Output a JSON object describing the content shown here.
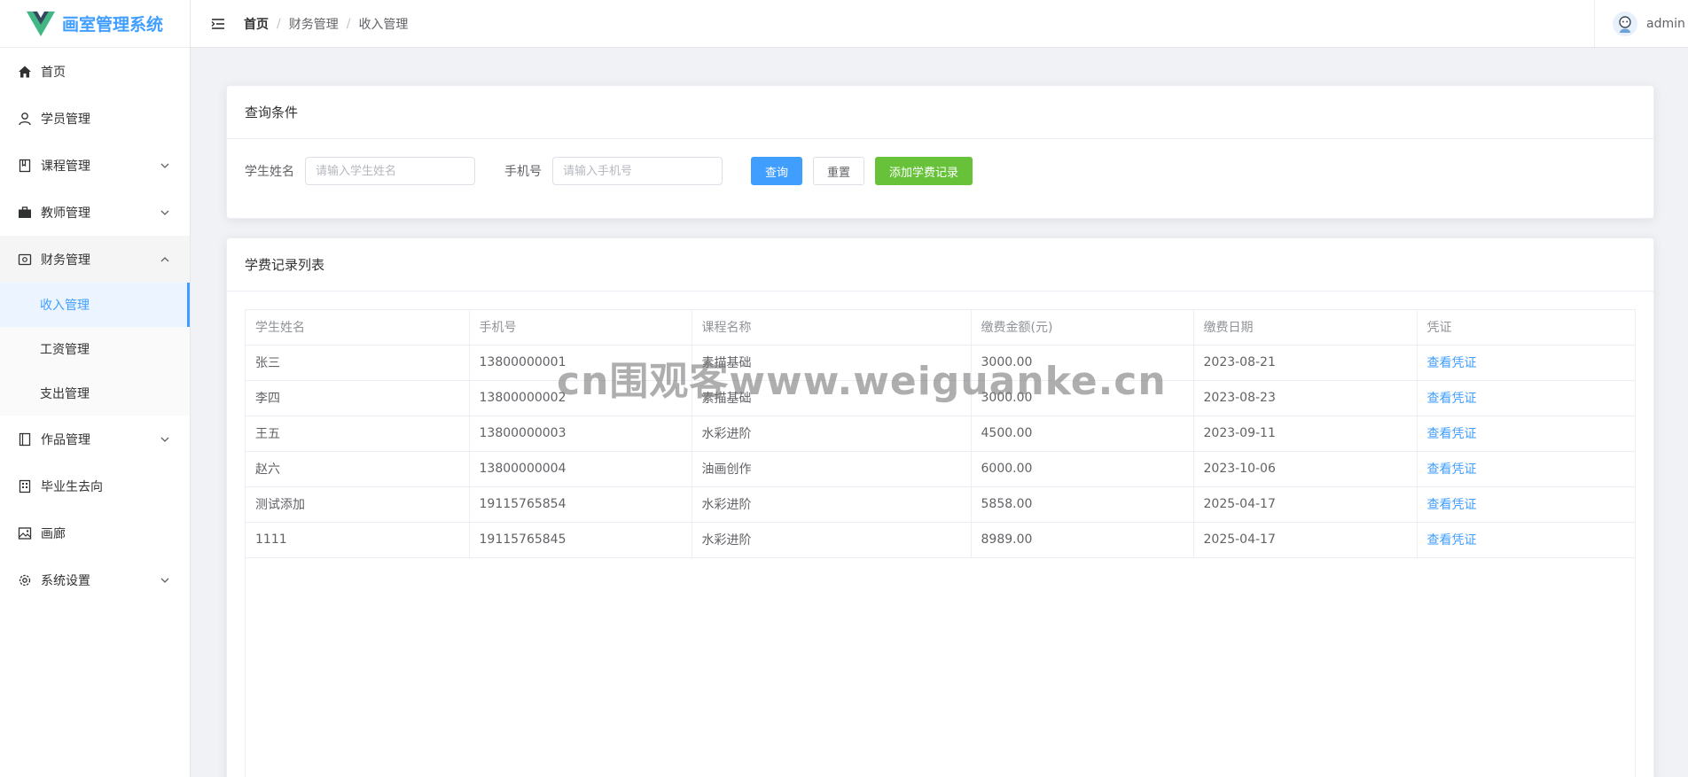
{
  "app": {
    "title": "画室管理系统",
    "brand_color": "#409eff"
  },
  "sidebar": {
    "items": [
      {
        "label": "首页",
        "icon": "home-icon"
      },
      {
        "label": "学员管理",
        "icon": "user-icon"
      },
      {
        "label": "课程管理",
        "icon": "book-icon"
      },
      {
        "label": "教师管理",
        "icon": "briefcase-icon"
      },
      {
        "label": "财务管理",
        "icon": "wallet-icon"
      },
      {
        "label": "作品管理",
        "icon": "notebook-icon"
      },
      {
        "label": "毕业生去向",
        "icon": "building-icon"
      },
      {
        "label": "画廊",
        "icon": "picture-icon"
      },
      {
        "label": "系统设置",
        "icon": "gear-icon"
      }
    ],
    "finance_sub": [
      {
        "label": "收入管理"
      },
      {
        "label": "工资管理"
      },
      {
        "label": "支出管理"
      }
    ]
  },
  "header": {
    "breadcrumb": [
      "首页",
      "财务管理",
      "收入管理"
    ],
    "separator": "/",
    "username": "admin"
  },
  "query": {
    "title": "查询条件",
    "name_label": "学生姓名",
    "name_placeholder": "请输入学生姓名",
    "phone_label": "手机号",
    "phone_placeholder": "请输入手机号",
    "search_label": "查询",
    "reset_label": "重置",
    "add_label": "添加学费记录"
  },
  "list": {
    "title": "学费记录列表",
    "columns": [
      "学生姓名",
      "手机号",
      "课程名称",
      "缴费金额(元)",
      "缴费日期",
      "凭证"
    ],
    "rows": [
      [
        "张三",
        "13800000001",
        "素描基础",
        "3000.00",
        "2023-08-21",
        "查看凭证"
      ],
      [
        "李四",
        "13800000002",
        "素描基础",
        "3000.00",
        "2023-08-23",
        "查看凭证"
      ],
      [
        "王五",
        "13800000003",
        "水彩进阶",
        "4500.00",
        "2023-09-11",
        "查看凭证"
      ],
      [
        "赵六",
        "13800000004",
        "油画创作",
        "6000.00",
        "2023-10-06",
        "查看凭证"
      ],
      [
        "测试添加",
        "19115765854",
        "水彩进阶",
        "5858.00",
        "2025-04-17",
        "查看凭证"
      ],
      [
        "1111",
        "19115765845",
        "水彩进阶",
        "8989.00",
        "2025-04-17",
        "查看凭证"
      ]
    ]
  },
  "watermark": "cn围观客www.weiguanke.cn"
}
